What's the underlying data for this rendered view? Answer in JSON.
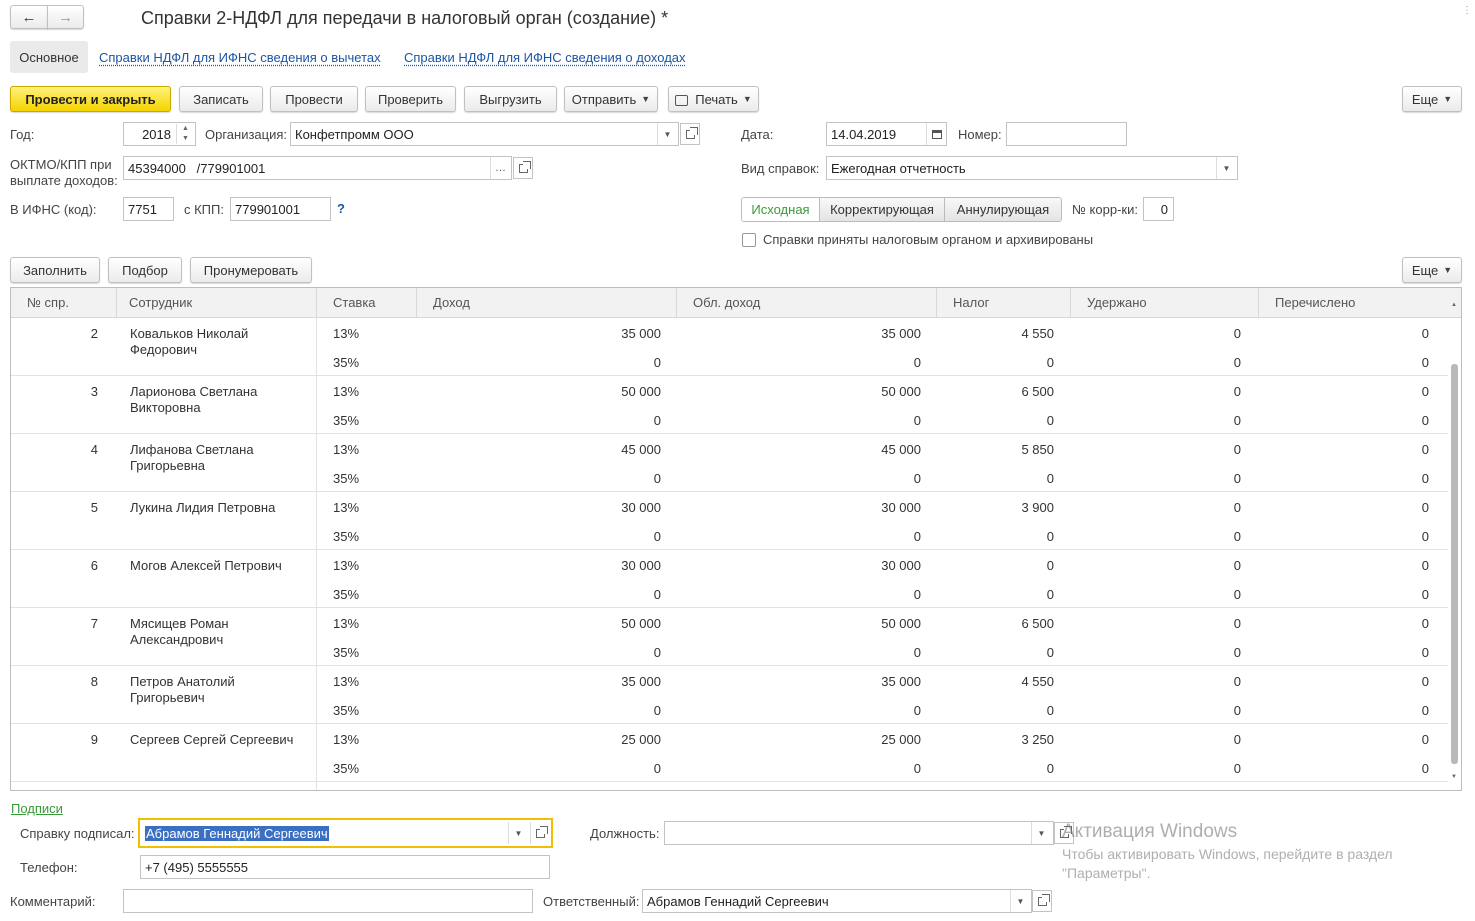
{
  "window": {
    "title": "Справки 2-НДФЛ для передачи в налоговый орган (создание) *"
  },
  "tabs": [
    {
      "label": "Основное"
    },
    {
      "label": "Справки НДФЛ для ИФНС сведения о вычетах"
    },
    {
      "label": "Справки НДФЛ для ИФНС сведения о доходах"
    }
  ],
  "toolbar": {
    "post_close": "Провести и закрыть",
    "save": "Записать",
    "post": "Провести",
    "check": "Проверить",
    "unload": "Выгрузить",
    "send": "Отправить",
    "print": "Печать",
    "more": "Еще"
  },
  "form": {
    "year_label": "Год:",
    "year": "2018",
    "org_label": "Организация:",
    "org": "Конфетпромм ООО",
    "date_label": "Дата:",
    "date": "14.04.2019",
    "number_label": "Номер:",
    "number": "",
    "oktmo_label": "ОКТМО/КПП при выплате доходов:",
    "oktmo": "45394000   /779901001",
    "kind_label": "Вид справок:",
    "kind": "Ежегодная отчетность",
    "ifns_label": "В ИФНС (код):",
    "ifns": "7751",
    "kpp_label": "с КПП:",
    "kpp": "779901001",
    "help": "?",
    "mode_options": [
      "Исходная",
      "Корректирующая",
      "Аннулирующая"
    ],
    "corr_label": "№ корр-ки:",
    "corr": "0",
    "archived_label": "Справки приняты налоговым органом и архивированы",
    "archived": false
  },
  "table_toolbar": {
    "fill": "Заполнить",
    "pick": "Подбор",
    "renumber": "Пронумеровать",
    "more": "Еще"
  },
  "table": {
    "columns": [
      "№ спр.",
      "Сотрудник",
      "Ставка",
      "Доход",
      "Обл. доход",
      "Налог",
      "Удержано",
      "Перечислено"
    ],
    "rows": [
      {
        "num": "2",
        "employee": "Ковальков Николай Федорович",
        "rates": [
          {
            "rate": "13%",
            "income": "35 000",
            "taxable": "35 000",
            "tax": "4 550",
            "withheld": "0",
            "paid": "0"
          },
          {
            "rate": "35%",
            "income": "0",
            "taxable": "0",
            "tax": "0",
            "withheld": "0",
            "paid": "0"
          }
        ]
      },
      {
        "num": "3",
        "employee": "Ларионова Светлана Викторовна",
        "rates": [
          {
            "rate": "13%",
            "income": "50 000",
            "taxable": "50 000",
            "tax": "6 500",
            "withheld": "0",
            "paid": "0"
          },
          {
            "rate": "35%",
            "income": "0",
            "taxable": "0",
            "tax": "0",
            "withheld": "0",
            "paid": "0"
          }
        ]
      },
      {
        "num": "4",
        "employee": "Лифанова Светлана Григорьевна",
        "rates": [
          {
            "rate": "13%",
            "income": "45 000",
            "taxable": "45 000",
            "tax": "5 850",
            "withheld": "0",
            "paid": "0"
          },
          {
            "rate": "35%",
            "income": "0",
            "taxable": "0",
            "tax": "0",
            "withheld": "0",
            "paid": "0"
          }
        ]
      },
      {
        "num": "5",
        "employee": "Лукина Лидия Петровна",
        "rates": [
          {
            "rate": "13%",
            "income": "30 000",
            "taxable": "30 000",
            "tax": "3 900",
            "withheld": "0",
            "paid": "0"
          },
          {
            "rate": "35%",
            "income": "0",
            "taxable": "0",
            "tax": "0",
            "withheld": "0",
            "paid": "0"
          }
        ]
      },
      {
        "num": "6",
        "employee": "Могов Алексей Петрович",
        "rates": [
          {
            "rate": "13%",
            "income": "30 000",
            "taxable": "30 000",
            "tax": "0",
            "withheld": "0",
            "paid": "0"
          },
          {
            "rate": "35%",
            "income": "0",
            "taxable": "0",
            "tax": "0",
            "withheld": "0",
            "paid": "0"
          }
        ]
      },
      {
        "num": "7",
        "employee": "Мясищев Роман Александрович",
        "rates": [
          {
            "rate": "13%",
            "income": "50 000",
            "taxable": "50 000",
            "tax": "6 500",
            "withheld": "0",
            "paid": "0"
          },
          {
            "rate": "35%",
            "income": "0",
            "taxable": "0",
            "tax": "0",
            "withheld": "0",
            "paid": "0"
          }
        ]
      },
      {
        "num": "8",
        "employee": "Петров Анатолий Григорьевич",
        "rates": [
          {
            "rate": "13%",
            "income": "35 000",
            "taxable": "35 000",
            "tax": "4 550",
            "withheld": "0",
            "paid": "0"
          },
          {
            "rate": "35%",
            "income": "0",
            "taxable": "0",
            "tax": "0",
            "withheld": "0",
            "paid": "0"
          }
        ]
      },
      {
        "num": "9",
        "employee": "Сергеев Сергей Сергеевич",
        "rates": [
          {
            "rate": "13%",
            "income": "25 000",
            "taxable": "25 000",
            "tax": "3 250",
            "withheld": "0",
            "paid": "0"
          },
          {
            "rate": "35%",
            "income": "0",
            "taxable": "0",
            "tax": "0",
            "withheld": "0",
            "paid": "0"
          }
        ]
      }
    ]
  },
  "signatures": {
    "section": "Подписи",
    "signed_label": "Справку подписал:",
    "signed": "Абрамов Геннадий Сергеевич",
    "position_label": "Должность:",
    "position": "",
    "phone_label": "Телефон:",
    "phone": "+7 (495) 5555555"
  },
  "footer": {
    "comment_label": "Комментарий:",
    "comment": "",
    "responsible_label": "Ответственный:",
    "responsible": "Абрамов Геннадий Сергеевич"
  },
  "watermark": {
    "title": "Активация Windows",
    "line1": "Чтобы активировать Windows, перейдите в раздел",
    "line2": "\"Параметры\"."
  },
  "colors": {
    "primary": "#f5d400",
    "link": "#1a55a5",
    "section_link": "#3a9a3a",
    "selection": "#3b6fc1",
    "focus": "#f0c000"
  }
}
